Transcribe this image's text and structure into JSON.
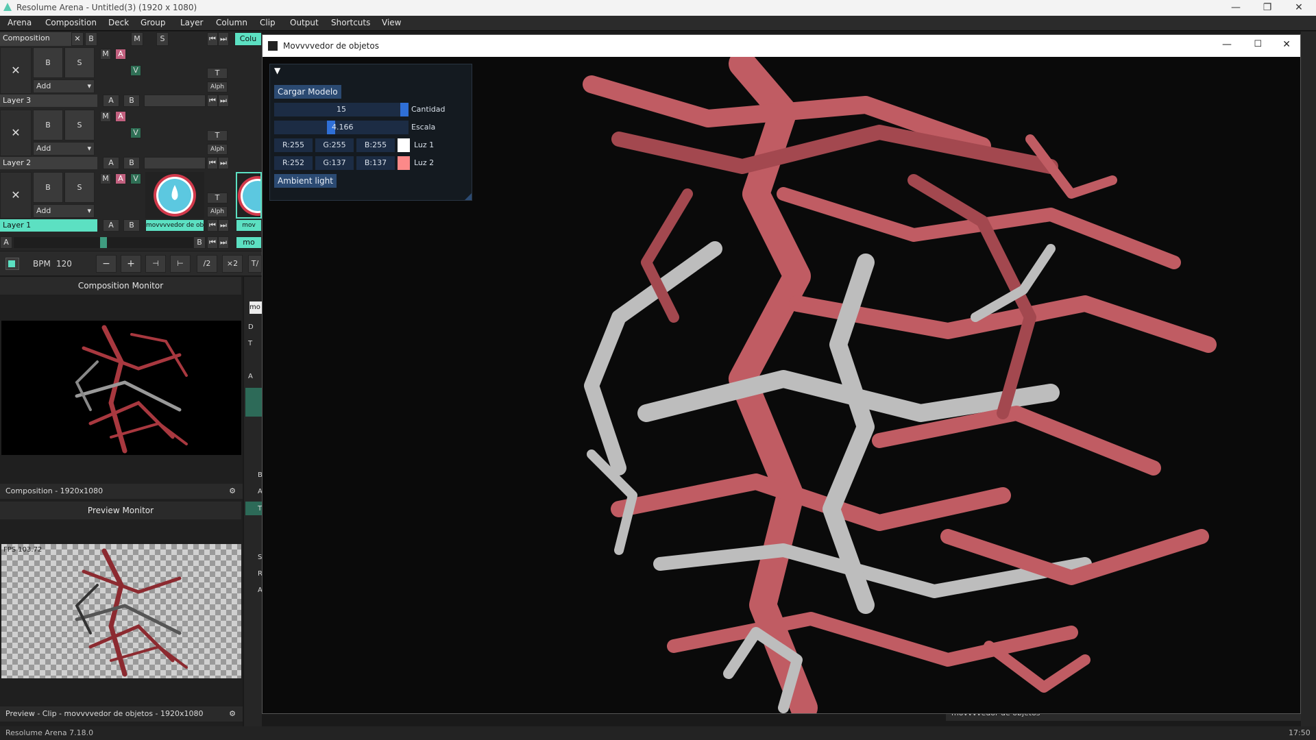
{
  "window": {
    "title": "Resolume Arena - Untitled(3) (1920 x 1080)"
  },
  "menu": [
    "Arena",
    "Composition",
    "Deck",
    "Group",
    "Layer",
    "Column",
    "Clip",
    "Output",
    "Shortcuts",
    "View"
  ],
  "composition": {
    "label": "Composition",
    "b": "B",
    "m": "M",
    "s": "S",
    "column_tab": "Colu"
  },
  "layers": [
    {
      "name": "Layer 3",
      "add": "Add",
      "b": "B",
      "s": "S",
      "m": "M",
      "a": "A",
      "v": "V",
      "t": "T",
      "alph": "Alph",
      "ab_a": "A",
      "ab_b": "B"
    },
    {
      "name": "Layer 2",
      "add": "Add",
      "b": "B",
      "s": "S",
      "m": "M",
      "a": "A",
      "v": "V",
      "t": "T",
      "alph": "Alph",
      "ab_a": "A",
      "ab_b": "B"
    },
    {
      "name": "Layer 1",
      "add": "Add",
      "b": "B",
      "s": "S",
      "m": "M",
      "a": "A",
      "v": "V",
      "t": "T",
      "alph": "Alph",
      "ab_a": "A",
      "ab_b": "B",
      "clip_label": "movvvvedor de ob...",
      "clip2_label": "mov"
    }
  ],
  "crossfader": {
    "a": "A",
    "b": "B",
    "column2": "mo"
  },
  "bpm": {
    "label": "BPM",
    "value": "120",
    "minus": "−",
    "plus": "+",
    "half": "/2",
    "double": "×2",
    "tap": "T/"
  },
  "comp_monitor": {
    "title": "Composition Monitor",
    "footer": "Composition - 1920x1080"
  },
  "preview_monitor": {
    "title": "Preview Monitor",
    "fps": "FPS 103.72",
    "footer": "Preview - Clip - movvvvedor de objetos - 1920x1080"
  },
  "mid_col": {
    "input_text": "mo",
    "rows": [
      "D",
      "T",
      "A",
      "B",
      "A",
      "T",
      "S",
      "R",
      "A"
    ]
  },
  "of_window": {
    "title": "Movvvvedor de objetos",
    "load_button": "Cargar Modelo",
    "cantidad": {
      "value": "15",
      "label": "Cantidad",
      "fill": 1.0
    },
    "escala": {
      "value": "4.166",
      "label": "Escala",
      "fill": 0.42
    },
    "luz1": {
      "r": "R:255",
      "g": "G:255",
      "b": "B:255",
      "label": "Luz 1",
      "color": "#ffffff"
    },
    "luz2": {
      "r": "R:252",
      "g": "G:137",
      "b": "B:137",
      "label": "Luz 2",
      "color": "#fc8989"
    },
    "ambient_button": "Ambient light"
  },
  "bottom_clip_name": "movvvvedor de objetos",
  "status": {
    "version": "Resolume Arena 7.18.0",
    "time": "17:50"
  },
  "colors": {
    "accent": "#5ce0c2",
    "slider_blue": "#2f6fd6",
    "model_red": "#b8505a",
    "model_grey": "#b9b9b9"
  }
}
